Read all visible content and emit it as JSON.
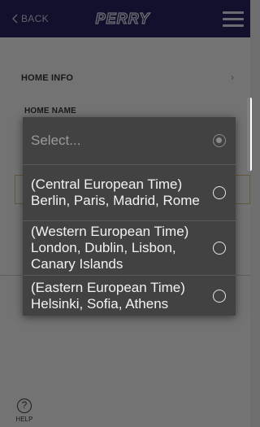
{
  "header": {
    "back_label": "BACK",
    "logo_text": "PERRY"
  },
  "home": {
    "section_title": "HOME INFO",
    "chevron": "›",
    "name_label": "HOME NAME"
  },
  "footer": {
    "help_glyph": "?",
    "help_label": "HELP"
  },
  "dropdown": {
    "options": [
      {
        "label": "Select...",
        "selected": true
      },
      {
        "label": "(Central European Time) Berlin, Paris, Madrid, Rome",
        "selected": false
      },
      {
        "label": "(Western European Time) London, Dublin, Lisbon, Canary Islands",
        "selected": false
      },
      {
        "label": "(Eastern European Time) Helsinki, Sofia, Athens",
        "selected": false
      }
    ]
  },
  "colors": {
    "topbar": "#23235a",
    "dialog": "#424242",
    "field_border": "#c7b27a"
  }
}
